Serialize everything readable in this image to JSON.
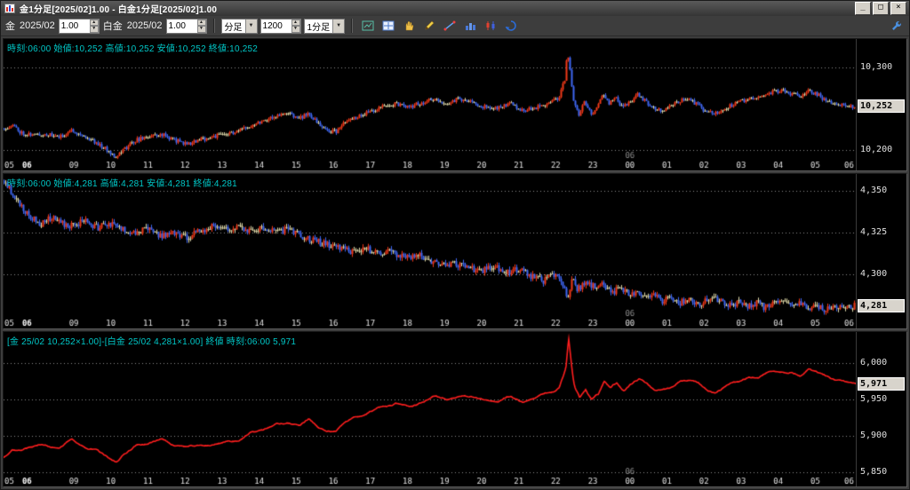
{
  "window": {
    "title": "金1分足[2025/02]1.00 - 白金1分足[2025/02]1.00",
    "buttons": {
      "minimize": "_",
      "maximize": "□",
      "close": "×"
    }
  },
  "toolbar": {
    "gold_label": "金",
    "gold_contract": "2025/02",
    "gold_multiplier": "1.00",
    "platinum_label": "白金",
    "platinum_contract": "2025/02",
    "platinum_multiplier": "1.00",
    "period_type": "分足",
    "bar_count": "1200",
    "period": "1分足",
    "spinner_up": "▲",
    "spinner_down": "▼",
    "dropdown_arrow": "▼",
    "icons": [
      "chart-window-icon",
      "crosshair-icon",
      "hand-tool-icon",
      "pencil-icon",
      "trendline-icon",
      "bar-chart-icon",
      "candle-indicator-icon",
      "refresh-icon",
      "wrench-icon"
    ]
  },
  "panels": [
    {
      "name": "gold",
      "info": "時刻:06:00 始値:10,252 高値:10,252 安値:10,252 終値:10,252"
    },
    {
      "name": "platinum",
      "info": "時刻:06:00 始値:4,281 高値:4,281 安値:4,281 終値:4,281"
    },
    {
      "name": "spread",
      "info": "[金 25/02 10,252×1.00]-[白金 25/02 4,281×1.00] 終値 時刻:06:00 5,971"
    }
  ],
  "xaxis": {
    "ticks": [
      {
        "label": "05",
        "frac": 0.006
      },
      {
        "label": "06",
        "frac": 0.027,
        "bold": true
      },
      {
        "label": "09",
        "frac": 0.082
      },
      {
        "label": "10",
        "frac": 0.1255
      },
      {
        "label": "11",
        "frac": 0.169
      },
      {
        "label": "12",
        "frac": 0.2125
      },
      {
        "label": "13",
        "frac": 0.256
      },
      {
        "label": "14",
        "frac": 0.2995
      },
      {
        "label": "15",
        "frac": 0.343
      },
      {
        "label": "16",
        "frac": 0.3865
      },
      {
        "label": "17",
        "frac": 0.43
      },
      {
        "label": "18",
        "frac": 0.4735
      },
      {
        "label": "19",
        "frac": 0.517
      },
      {
        "label": "20",
        "frac": 0.5605
      },
      {
        "label": "21",
        "frac": 0.604
      },
      {
        "label": "22",
        "frac": 0.6475
      },
      {
        "label": "23",
        "frac": 0.691
      },
      {
        "label": "00",
        "frac": 0.7345
      },
      {
        "label": "01",
        "frac": 0.778
      },
      {
        "label": "02",
        "frac": 0.8215
      },
      {
        "label": "03",
        "frac": 0.865
      },
      {
        "label": "04",
        "frac": 0.9085
      },
      {
        "label": "05",
        "frac": 0.952
      },
      {
        "label": "06",
        "frac": 0.9955
      }
    ],
    "date_mark": {
      "label": "06",
      "frac": 0.7345
    }
  },
  "chart_data": [
    {
      "type": "candle",
      "title": "金 1分足 [2025/02]",
      "ylim": [
        10188,
        10332
      ],
      "gridlines": [
        {
          "value": 10300,
          "label": "10,300"
        },
        {
          "value": 10200,
          "label": "10,200"
        }
      ],
      "last": {
        "value": 10252,
        "label": "10,252"
      },
      "bars": 480,
      "noise": 5,
      "seed": 11,
      "keyframes": [
        [
          0.0,
          10226
        ],
        [
          0.01,
          10230
        ],
        [
          0.02,
          10221
        ],
        [
          0.035,
          10218
        ],
        [
          0.05,
          10219
        ],
        [
          0.065,
          10215
        ],
        [
          0.08,
          10224
        ],
        [
          0.095,
          10216
        ],
        [
          0.11,
          10208
        ],
        [
          0.125,
          10197
        ],
        [
          0.132,
          10192
        ],
        [
          0.14,
          10200
        ],
        [
          0.155,
          10212
        ],
        [
          0.17,
          10216
        ],
        [
          0.185,
          10219
        ],
        [
          0.2,
          10212
        ],
        [
          0.215,
          10207
        ],
        [
          0.23,
          10212
        ],
        [
          0.245,
          10216
        ],
        [
          0.26,
          10219
        ],
        [
          0.275,
          10222
        ],
        [
          0.29,
          10230
        ],
        [
          0.305,
          10236
        ],
        [
          0.32,
          10241
        ],
        [
          0.335,
          10244
        ],
        [
          0.348,
          10238
        ],
        [
          0.358,
          10245
        ],
        [
          0.368,
          10232
        ],
        [
          0.378,
          10224
        ],
        [
          0.39,
          10222
        ],
        [
          0.4,
          10232
        ],
        [
          0.415,
          10240
        ],
        [
          0.43,
          10247
        ],
        [
          0.445,
          10252
        ],
        [
          0.46,
          10256
        ],
        [
          0.475,
          10251
        ],
        [
          0.49,
          10257
        ],
        [
          0.505,
          10261
        ],
        [
          0.52,
          10255
        ],
        [
          0.535,
          10262
        ],
        [
          0.55,
          10258
        ],
        [
          0.565,
          10252
        ],
        [
          0.58,
          10250
        ],
        [
          0.595,
          10257
        ],
        [
          0.61,
          10248
        ],
        [
          0.625,
          10251
        ],
        [
          0.64,
          10256
        ],
        [
          0.652,
          10262
        ],
        [
          0.66,
          10285
        ],
        [
          0.663,
          10320
        ],
        [
          0.666,
          10295
        ],
        [
          0.67,
          10262
        ],
        [
          0.676,
          10242
        ],
        [
          0.683,
          10257
        ],
        [
          0.69,
          10244
        ],
        [
          0.698,
          10250
        ],
        [
          0.705,
          10269
        ],
        [
          0.712,
          10256
        ],
        [
          0.72,
          10262
        ],
        [
          0.728,
          10251
        ],
        [
          0.738,
          10259
        ],
        [
          0.746,
          10268
        ],
        [
          0.755,
          10258
        ],
        [
          0.765,
          10251
        ],
        [
          0.775,
          10248
        ],
        [
          0.785,
          10253
        ],
        [
          0.795,
          10259
        ],
        [
          0.805,
          10262
        ],
        [
          0.815,
          10255
        ],
        [
          0.825,
          10247
        ],
        [
          0.835,
          10243
        ],
        [
          0.845,
          10249
        ],
        [
          0.855,
          10254
        ],
        [
          0.865,
          10258
        ],
        [
          0.875,
          10261
        ],
        [
          0.885,
          10263
        ],
        [
          0.895,
          10266
        ],
        [
          0.905,
          10270
        ],
        [
          0.915,
          10272
        ],
        [
          0.925,
          10268
        ],
        [
          0.935,
          10265
        ],
        [
          0.945,
          10271
        ],
        [
          0.955,
          10268
        ],
        [
          0.965,
          10261
        ],
        [
          0.975,
          10257
        ],
        [
          0.985,
          10254
        ],
        [
          1.0,
          10252
        ]
      ]
    },
    {
      "type": "candle",
      "title": "白金 1分足 [2025/02]",
      "ylim": [
        4274,
        4359
      ],
      "gridlines": [
        {
          "value": 4350,
          "label": "4,350"
        },
        {
          "value": 4325,
          "label": "4,325"
        },
        {
          "value": 4300,
          "label": "4,300"
        }
      ],
      "last": {
        "value": 4281,
        "label": "4,281"
      },
      "bars": 480,
      "noise": 4,
      "seed": 23,
      "keyframes": [
        [
          0.0,
          4356
        ],
        [
          0.008,
          4350
        ],
        [
          0.016,
          4344
        ],
        [
          0.025,
          4337
        ],
        [
          0.035,
          4333
        ],
        [
          0.045,
          4330
        ],
        [
          0.055,
          4334
        ],
        [
          0.065,
          4331
        ],
        [
          0.08,
          4329
        ],
        [
          0.095,
          4332
        ],
        [
          0.11,
          4328
        ],
        [
          0.125,
          4330
        ],
        [
          0.14,
          4327
        ],
        [
          0.155,
          4325
        ],
        [
          0.17,
          4327
        ],
        [
          0.185,
          4323
        ],
        [
          0.2,
          4325
        ],
        [
          0.215,
          4322
        ],
        [
          0.23,
          4326
        ],
        [
          0.245,
          4329
        ],
        [
          0.26,
          4327
        ],
        [
          0.275,
          4329
        ],
        [
          0.29,
          4326
        ],
        [
          0.305,
          4328
        ],
        [
          0.32,
          4325
        ],
        [
          0.335,
          4327
        ],
        [
          0.35,
          4323
        ],
        [
          0.365,
          4320
        ],
        [
          0.38,
          4318
        ],
        [
          0.395,
          4316
        ],
        [
          0.41,
          4313
        ],
        [
          0.425,
          4316
        ],
        [
          0.44,
          4312
        ],
        [
          0.455,
          4314
        ],
        [
          0.47,
          4310
        ],
        [
          0.485,
          4312
        ],
        [
          0.5,
          4308
        ],
        [
          0.515,
          4305
        ],
        [
          0.53,
          4307
        ],
        [
          0.545,
          4304
        ],
        [
          0.56,
          4302
        ],
        [
          0.575,
          4305
        ],
        [
          0.59,
          4301
        ],
        [
          0.605,
          4303
        ],
        [
          0.62,
          4299
        ],
        [
          0.635,
          4296
        ],
        [
          0.648,
          4300
        ],
        [
          0.658,
          4294
        ],
        [
          0.663,
          4286
        ],
        [
          0.668,
          4297
        ],
        [
          0.675,
          4291
        ],
        [
          0.685,
          4296
        ],
        [
          0.695,
          4292
        ],
        [
          0.705,
          4294
        ],
        [
          0.715,
          4289
        ],
        [
          0.725,
          4292
        ],
        [
          0.735,
          4288
        ],
        [
          0.745,
          4290
        ],
        [
          0.755,
          4286
        ],
        [
          0.765,
          4288
        ],
        [
          0.775,
          4284
        ],
        [
          0.785,
          4286
        ],
        [
          0.795,
          4283
        ],
        [
          0.805,
          4285
        ],
        [
          0.815,
          4282
        ],
        [
          0.825,
          4284
        ],
        [
          0.835,
          4286
        ],
        [
          0.845,
          4283
        ],
        [
          0.855,
          4281
        ],
        [
          0.865,
          4284
        ],
        [
          0.875,
          4281
        ],
        [
          0.885,
          4283
        ],
        [
          0.895,
          4280
        ],
        [
          0.905,
          4282
        ],
        [
          0.915,
          4284
        ],
        [
          0.925,
          4281
        ],
        [
          0.935,
          4283
        ],
        [
          0.945,
          4280
        ],
        [
          0.955,
          4282
        ],
        [
          0.965,
          4279
        ],
        [
          0.975,
          4281
        ],
        [
          0.985,
          4280
        ],
        [
          1.0,
          4281
        ]
      ]
    },
    {
      "type": "line",
      "title": "[金 25/02 ×1.00]-[白金 25/02 ×1.00] スプレッド",
      "formula": "gold_minus_platinum",
      "ylim": [
        5845,
        6040
      ],
      "gridlines": [
        {
          "value": 6000,
          "label": "6,000"
        },
        {
          "value": 5950,
          "label": "5,950"
        },
        {
          "value": 5900,
          "label": "5,900"
        },
        {
          "value": 5850,
          "label": "5,850"
        }
      ],
      "last": {
        "value": 5971,
        "label": "5,971"
      },
      "noise": 1.2,
      "seed": 37
    }
  ],
  "colors": {
    "bg": "#000000",
    "chrome": "#3d3d3d",
    "up": "#f03818",
    "down": "#3e66f0",
    "flat": "#ded8a8",
    "spread": "#ff1e1e",
    "grid": "#8c8c8c",
    "info": "#00c8c8",
    "axis_text": "#e0e0e0",
    "tick_bold": "#ffffff",
    "date_mark": "#8a8a8a",
    "price_box_bg": "#d8d4cc",
    "price_box_text": "#000000"
  }
}
